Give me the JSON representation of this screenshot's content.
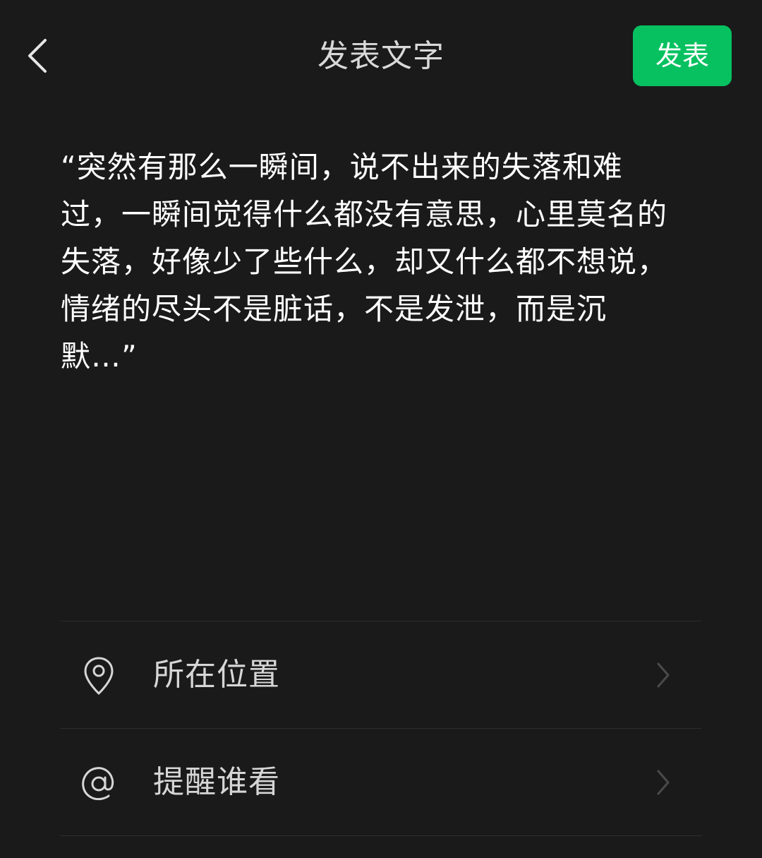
{
  "header": {
    "back_icon": "chevron-left-icon",
    "title": "发表文字",
    "post_label": "发表"
  },
  "colors": {
    "background": "#1a1a1a",
    "accent": "#07c160",
    "text": "#ffffff",
    "muted": "#d6d6d6",
    "divider": "#2e2e2e"
  },
  "post": {
    "text": "“突然有那么一瞬间，说不出来的失落和难过，一瞬间觉得什么都没有意思，心里莫名的失落，好像少了些什么，却又什么都不想说，情绪的尽头不是脏话，不是发泄，而是沉默…”"
  },
  "options": [
    {
      "icon": "location-pin-icon",
      "label": "所在位置"
    },
    {
      "icon": "at-sign-icon",
      "label": "提醒谁看"
    }
  ]
}
